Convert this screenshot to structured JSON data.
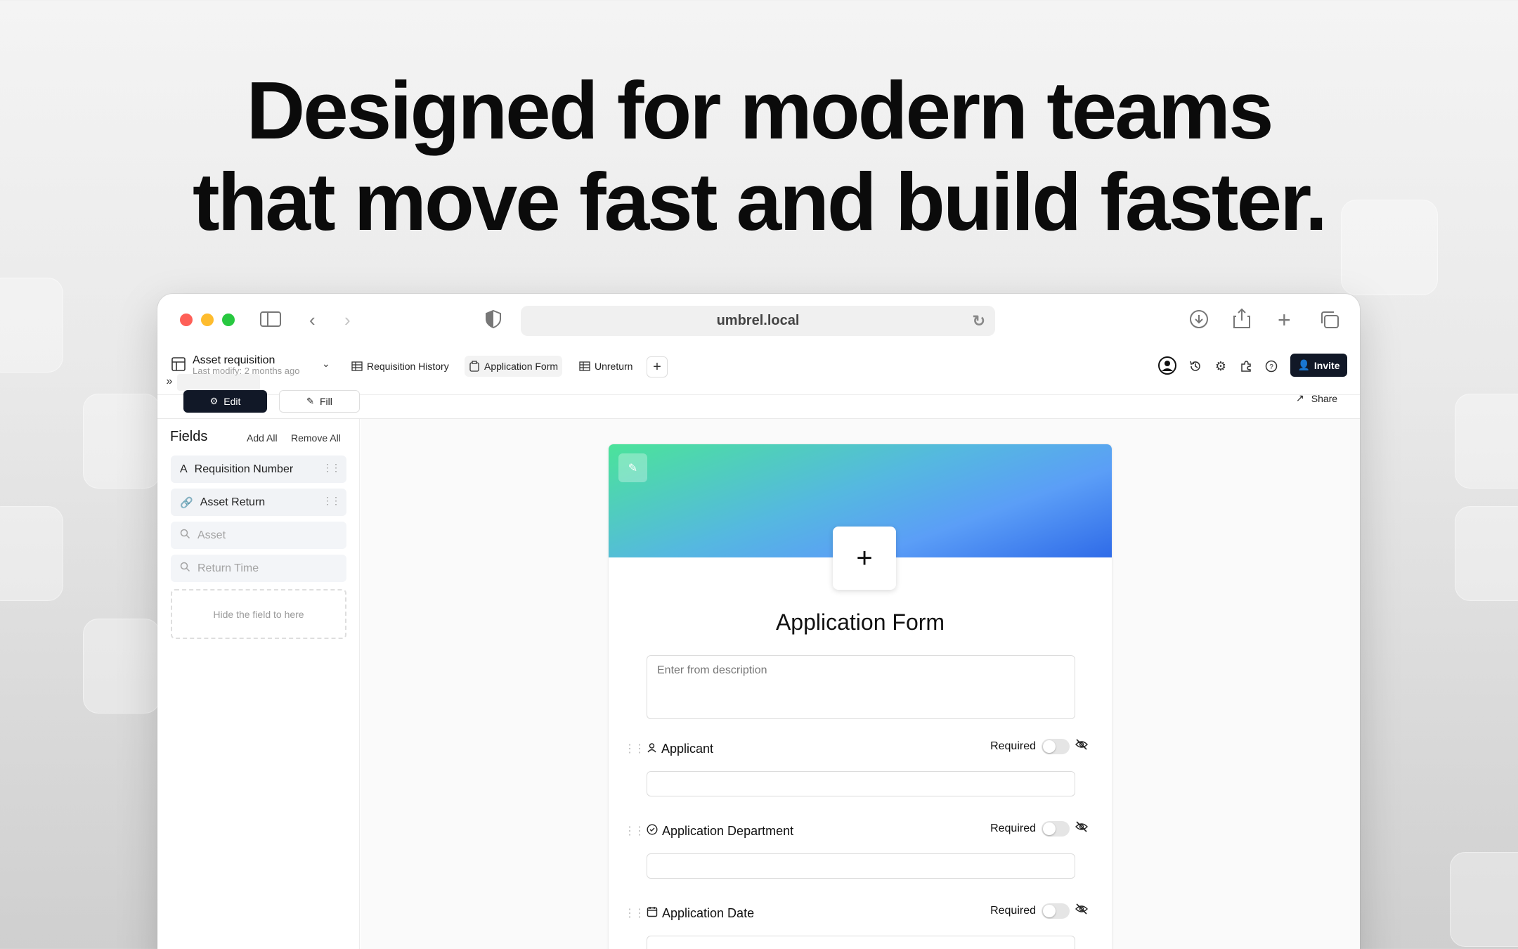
{
  "headline": {
    "line1": "Designed for modern teams",
    "line2": "that move fast and build faster."
  },
  "browser": {
    "url": "umbrel.local"
  },
  "app": {
    "title": "Asset requisition",
    "subtitle": "Last modify: 2 months ago",
    "tabs": [
      {
        "label": "Requisition History",
        "icon": "grid-icon"
      },
      {
        "label": "Application Form",
        "icon": "clipboard-icon"
      },
      {
        "label": "Unreturn",
        "icon": "grid-icon"
      }
    ],
    "add_tab": "+",
    "invite_label": "Invite",
    "share_label": "Share"
  },
  "toolbar": {
    "edit_label": "Edit",
    "fill_label": "Fill"
  },
  "sidebar": {
    "title": "Fields",
    "add_all": "Add All",
    "remove_all": "Remove All",
    "fields": [
      {
        "label": "Requisition Number",
        "icon": "text-icon"
      },
      {
        "label": "Asset Return",
        "icon": "link-icon"
      },
      {
        "label": "Asset",
        "icon": "search-icon"
      },
      {
        "label": "Return Time",
        "icon": "search-icon"
      }
    ],
    "dropzone": "Hide the field to here"
  },
  "form": {
    "title": "Application Form",
    "description_placeholder": "Enter from description",
    "required_label": "Required",
    "questions": [
      {
        "label": "Applicant",
        "icon": "user-icon"
      },
      {
        "label": "Application Department",
        "icon": "check-circle-icon"
      },
      {
        "label": "Application Date",
        "icon": "calendar-icon"
      }
    ]
  },
  "colors": {
    "accent_dark": "#111827",
    "banner_green": "#4be39a",
    "banner_blue": "#2f6be8"
  }
}
